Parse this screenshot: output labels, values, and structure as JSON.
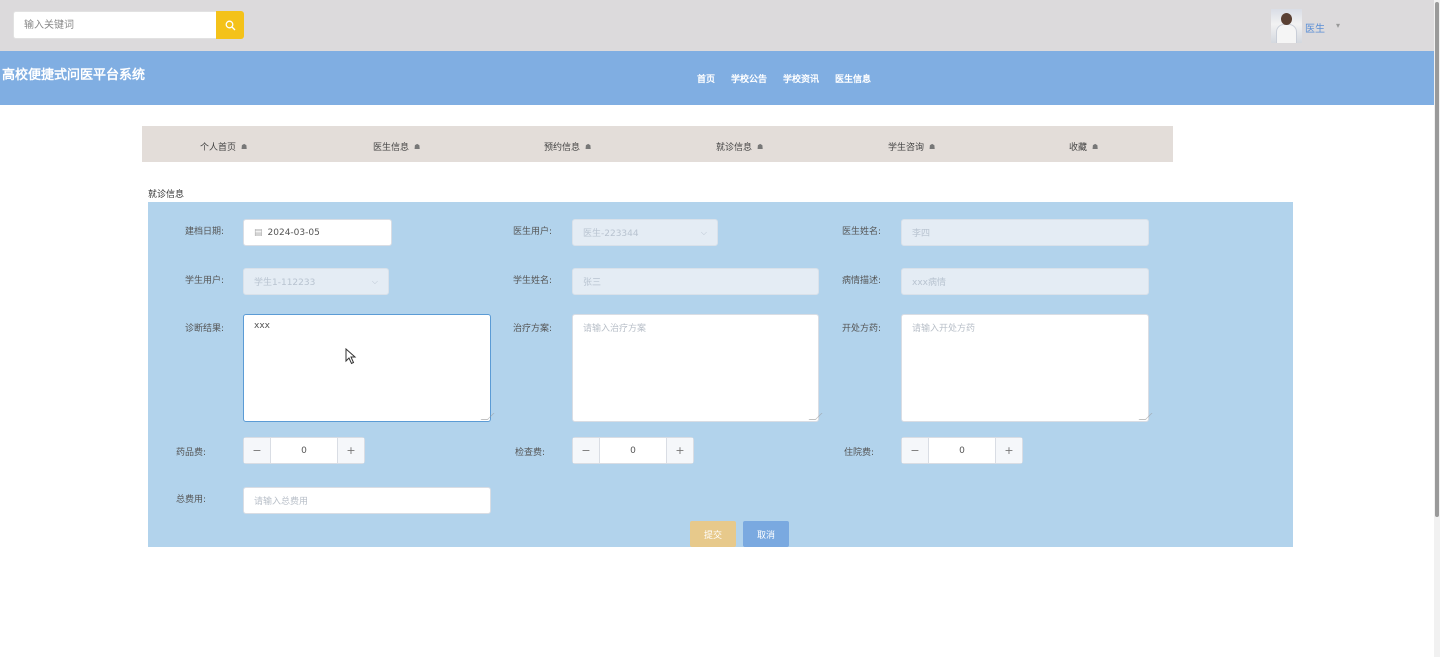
{
  "topbar": {
    "search_placeholder": "输入关键词",
    "search_icon": "search-icon",
    "user_name": "医生",
    "user_caret": "▾"
  },
  "header": {
    "site_title": "高校便捷式问医平台系统",
    "nav": [
      "首页",
      "学校公告",
      "学校资讯",
      "医生信息"
    ]
  },
  "subnav": {
    "items": [
      "个人首页",
      "医生信息",
      "预约信息",
      "就诊信息",
      "学生咨询",
      "收藏"
    ]
  },
  "section_title": "就诊信息",
  "form": {
    "record_date": {
      "label": "建档日期:",
      "value": "2024-03-05"
    },
    "doctor_user": {
      "label": "医生用户:",
      "value": "医生-223344"
    },
    "doctor_name": {
      "label": "医生姓名:",
      "value": "李四"
    },
    "student_user": {
      "label": "学生用户:",
      "value": "学生1-112233"
    },
    "student_name": {
      "label": "学生姓名:",
      "value": "张三"
    },
    "illness_desc": {
      "label": "病情描述:",
      "value": "xxx病情"
    },
    "diagnosis": {
      "label": "诊断结果:",
      "value": "xxx"
    },
    "treatment": {
      "label": "治疗方案:",
      "placeholder": "请输入治疗方案"
    },
    "prescription": {
      "label": "开处方药:",
      "placeholder": "请输入开处方药"
    },
    "drug_fee": {
      "label": "药品费:",
      "value": "0"
    },
    "exam_fee": {
      "label": "检查费:",
      "value": "0"
    },
    "hospital_fee": {
      "label": "住院费:",
      "value": "0"
    },
    "total_fee": {
      "label": "总费用:",
      "placeholder": "请输入总费用"
    },
    "submit_label": "提交",
    "cancel_label": "取消"
  },
  "colors": {
    "header_bg": "#80aee2",
    "panel_bg": "#b2d3ec",
    "submit_bg": "#e7c98b",
    "cancel_bg": "#7aa9e0",
    "search_btn": "#f4c21a"
  }
}
